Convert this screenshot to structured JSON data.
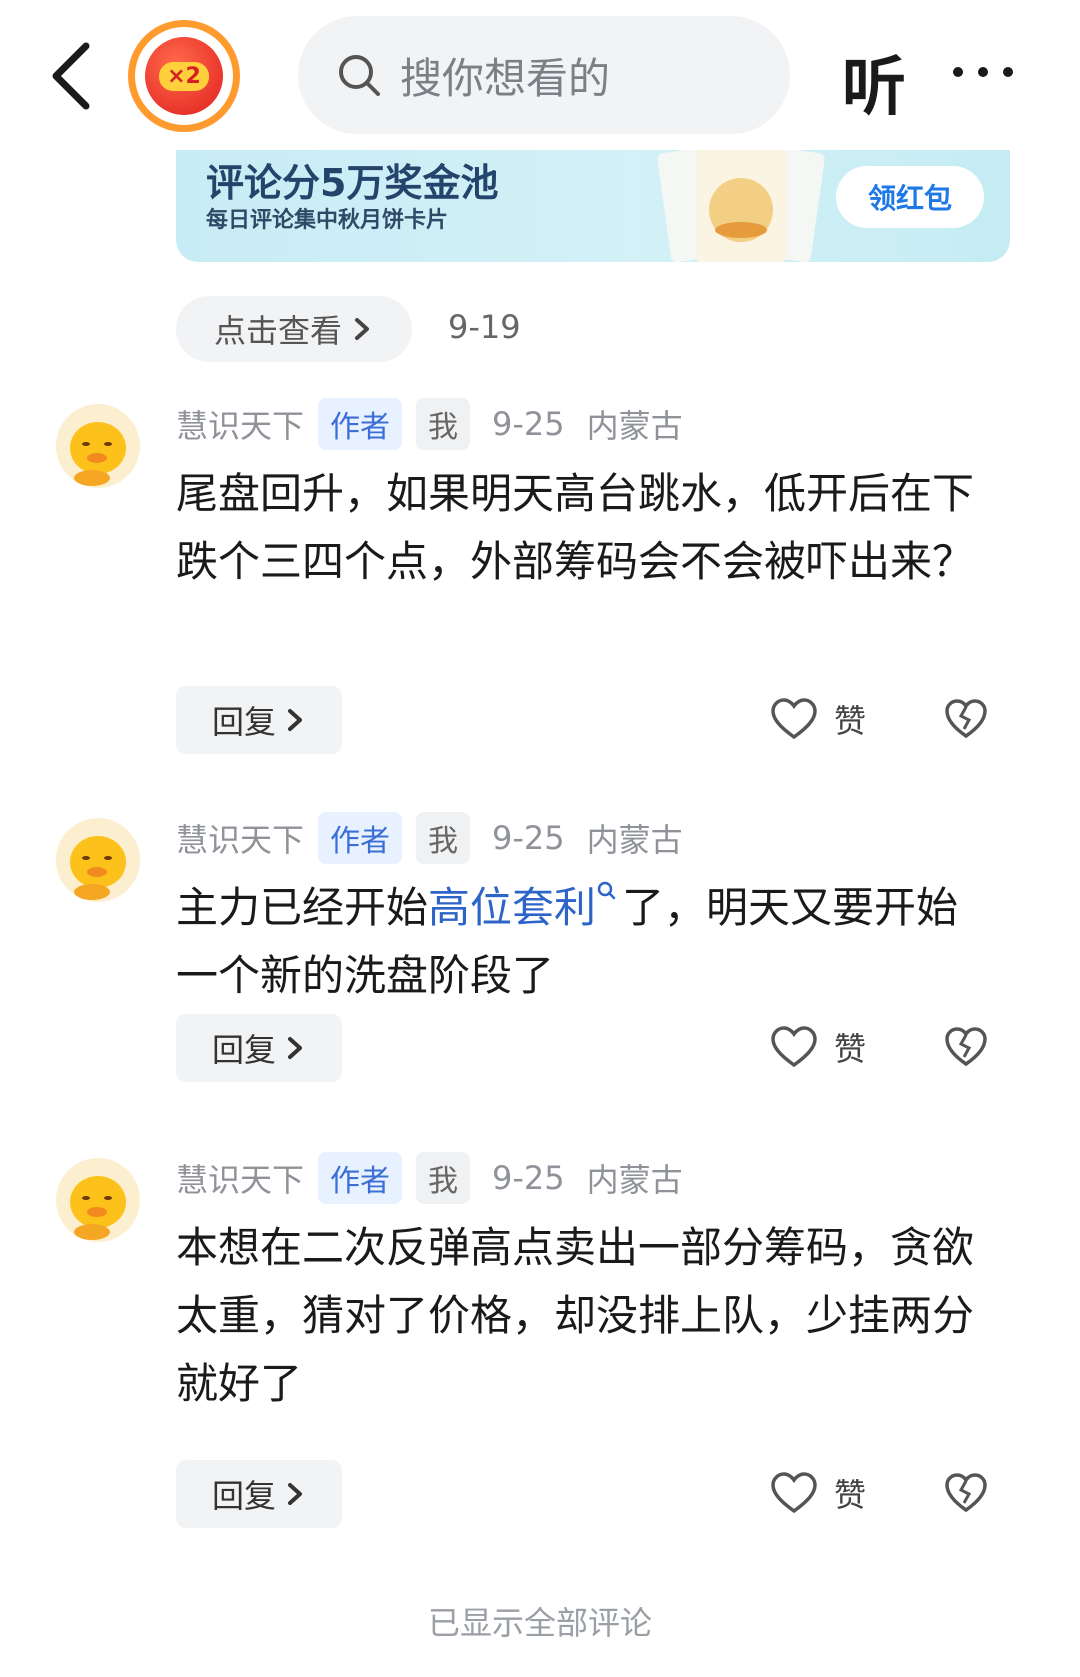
{
  "header": {
    "badge_label": "×2",
    "search_placeholder": "搜你想看的",
    "listen_label": "听"
  },
  "banner": {
    "title": "评论分5万奖金池",
    "subtitle": "每日评论集中秋月饼卡片",
    "button_label": "领红包"
  },
  "view": {
    "button_label": "点击查看",
    "date": "9-19"
  },
  "comments": [
    {
      "username": "慧识天下",
      "tag_author": "作者",
      "tag_me": "我",
      "date": "9-25",
      "location": "内蒙古",
      "text": "尾盘回升，如果明天高台跳水，低开后在下跌个三四个点，外部筹码会不会被吓出来？",
      "reply_label": "回复",
      "like_label": "赞"
    },
    {
      "username": "慧识天下",
      "tag_author": "作者",
      "tag_me": "我",
      "date": "9-25",
      "location": "内蒙古",
      "text_before": "主力已经开始",
      "link_text": "高位套利",
      "text_after": "了，明天又要开始一个新的洗盘阶段了",
      "reply_label": "回复",
      "like_label": "赞"
    },
    {
      "username": "慧识天下",
      "tag_author": "作者",
      "tag_me": "我",
      "date": "9-25",
      "location": "内蒙古",
      "text": "本想在二次反弹高点卖出一部分筹码，贪欲太重，猜对了价格，却没排上队，少挂两分就好了",
      "reply_label": "回复",
      "like_label": "赞"
    }
  ],
  "footer": {
    "text": "已显示全部评论"
  },
  "colors": {
    "accent_blue": "#2d64c8",
    "badge_orange": "#ff9a2e"
  }
}
